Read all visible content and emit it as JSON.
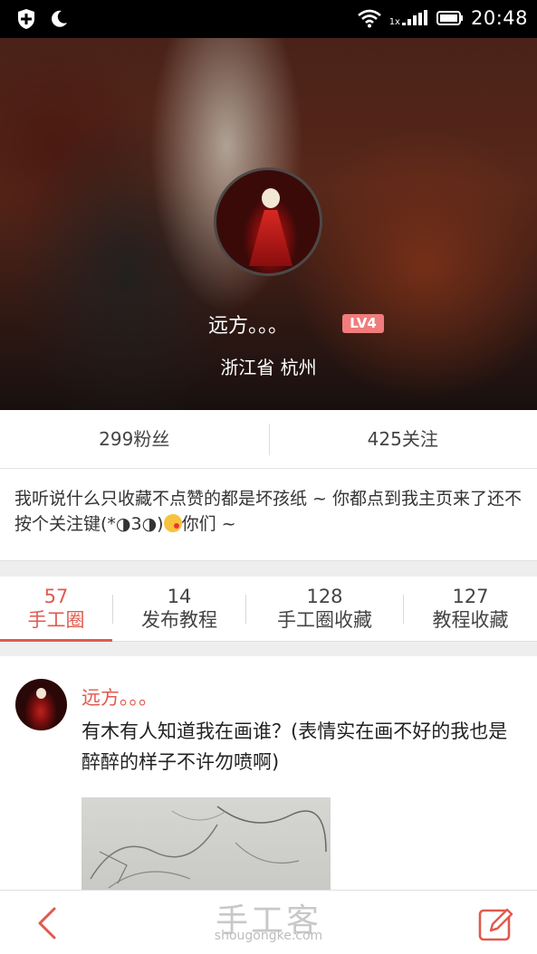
{
  "status_bar": {
    "time": "20:48",
    "network_label": "1x",
    "icons": [
      "shield-icon",
      "moon-icon",
      "wifi-icon",
      "signal-icon",
      "battery-icon"
    ]
  },
  "profile": {
    "name": "远方。。。",
    "level": "LV4",
    "location": "浙江省 杭州"
  },
  "stats": {
    "fans": "299粉丝",
    "following": "425关注"
  },
  "bio": {
    "part1": "我听说什么只收藏不点赞的都是坏孩纸 ~ 你都点到我主页来了还不按个关注键(*◑3◑)",
    "part2": "你们 ~"
  },
  "tabs": [
    {
      "count": "57",
      "label": "手工圈"
    },
    {
      "count": "14",
      "label": "发布教程"
    },
    {
      "count": "128",
      "label": "手工圈收藏"
    },
    {
      "count": "127",
      "label": "教程收藏"
    }
  ],
  "post": {
    "author": "远方。。。",
    "text": "有木有人知道我在画谁？(表情实在画不好的我也是醉醉的样子不许勿喷啊)"
  },
  "watermark": {
    "cn": "手工客",
    "en": "shougongke.com"
  },
  "colors": {
    "accent": "#e05a4e",
    "level_badge": "#f07c7c",
    "divider": "#eeeeee"
  }
}
